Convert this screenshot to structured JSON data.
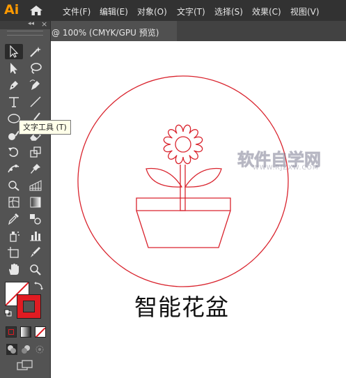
{
  "app": {
    "logo": "Ai"
  },
  "menu": [
    {
      "label": "文件(F)"
    },
    {
      "label": "编辑(E)"
    },
    {
      "label": "对象(O)"
    },
    {
      "label": "文字(T)"
    },
    {
      "label": "选择(S)"
    },
    {
      "label": "效果(C)"
    },
    {
      "label": "视图(V)"
    }
  ],
  "tab": {
    "title": "@ 100% (CMYK/GPU 预览)"
  },
  "tooltip": {
    "text": "文字工具 (T)"
  },
  "artwork": {
    "title": "智能花盆",
    "stroke_color": "#d9232d"
  },
  "watermark": {
    "main": "软件自学网",
    "url": "WWW.RJZXW.COM"
  },
  "toolbar": {
    "active_tool": "type-tool",
    "fill_color": "#ffffff",
    "stroke_color": "#e01b22"
  }
}
